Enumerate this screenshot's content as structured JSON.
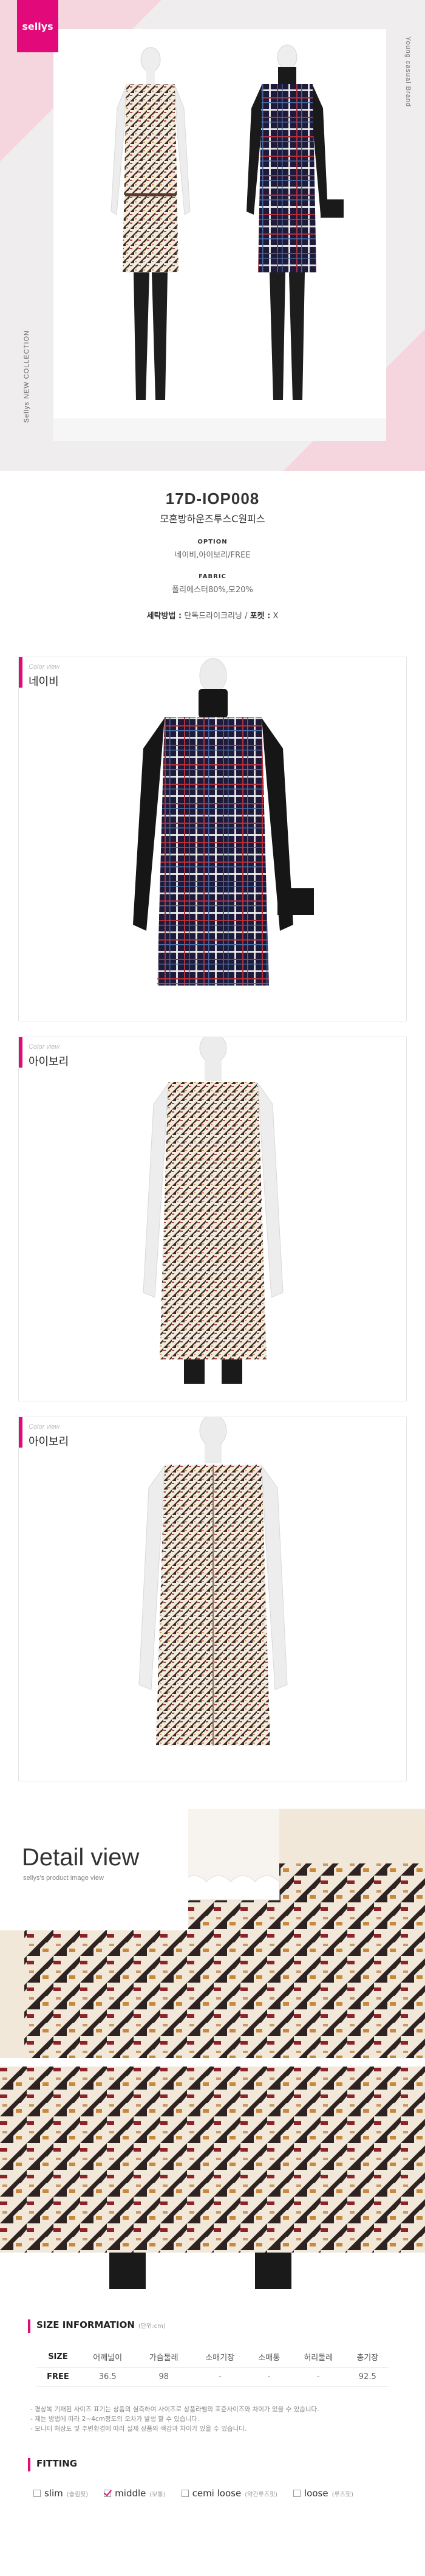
{
  "brand": {
    "logo": "sellys",
    "tagline_right": "Young casual Brand",
    "tagline_left": "Sellys NEW COLLECTION",
    "accent": "#e20a7a"
  },
  "product": {
    "code": "17D-IOP008",
    "name": "모혼방하운즈투스C원피스",
    "option_label": "OPTION",
    "option_value": "네이비,아이보리/FREE",
    "fabric_label": "FABRIC",
    "fabric_value": "폴리에스터80%,모20%",
    "wash_label": "세탁방법 :",
    "wash_value": "단독드라이크리닝",
    "lining_label": "포켓 :",
    "lining_value": "X"
  },
  "color_views": [
    {
      "small": "Color view",
      "label": "네이비"
    },
    {
      "small": "Color view",
      "label": "아이보리"
    },
    {
      "small": "Color view",
      "label": "아이보리"
    }
  ],
  "detail": {
    "title": "Detail view",
    "subtitle": "sellys's product image view"
  },
  "size_info": {
    "title": "SIZE INFORMATION",
    "unit": "(단위:cm)",
    "headers": [
      "SIZE",
      "어깨넓이",
      "가슴둘레",
      "소매기장",
      "소매통",
      "허리둘레",
      "총기장"
    ],
    "rows": [
      [
        "FREE",
        "36.5",
        "98",
        "-",
        "-",
        "-",
        "92.5"
      ]
    ],
    "notes": [
      "- 평상복 기재된 사이즈 표기는 상품의 실측하여 사이즈로 상품라벨의 표준사이즈와 차이가 있을 수 있습니다.",
      "- 재는 방법에 따라 2~4cm정도의 오차가 발생 할 수 있습니다.",
      "- 모니터 해상도 및 주변환경에 따라 실제 상품의 색감과 차이가 있을 수 있습니다."
    ]
  },
  "fitting": {
    "title": "FITTING",
    "options": [
      {
        "label": "slim",
        "note": "(슬림핏)",
        "checked": false
      },
      {
        "label": "middle",
        "note": "(보통)",
        "checked": true
      },
      {
        "label": "cemi loose",
        "note": "(약간루즈핏)",
        "checked": false
      },
      {
        "label": "loose",
        "note": "(루즈핏)",
        "checked": false
      }
    ]
  }
}
